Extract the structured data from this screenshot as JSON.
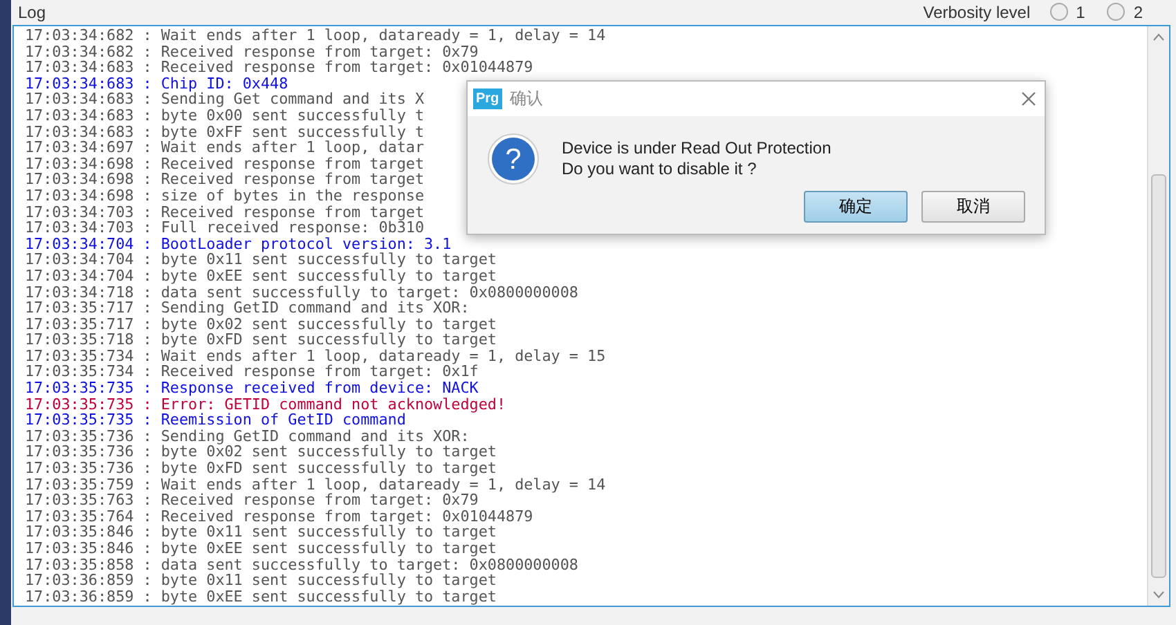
{
  "header": {
    "title": "Log",
    "verbosity": {
      "label": "Verbosity level",
      "options": [
        {
          "label": "1",
          "selected": false
        },
        {
          "label": "2",
          "selected": false
        }
      ]
    }
  },
  "log": {
    "lines": [
      {
        "kind": "info",
        "text": "17:03:34:682 : Wait ends after 1 loop, dataready = 1, delay = 14"
      },
      {
        "kind": "info",
        "text": "17:03:34:682 : Received response from target: 0x79"
      },
      {
        "kind": "info",
        "text": "17:03:34:683 : Received response from target: 0x01044879"
      },
      {
        "kind": "highlight",
        "text": "17:03:34:683 : Chip ID: 0x448"
      },
      {
        "kind": "info",
        "text": "17:03:34:683 : Sending Get command and its X"
      },
      {
        "kind": "info",
        "text": "17:03:34:683 : byte 0x00 sent successfully t"
      },
      {
        "kind": "info",
        "text": "17:03:34:683 : byte 0xFF sent successfully t"
      },
      {
        "kind": "info",
        "text": "17:03:34:697 : Wait ends after 1 loop, datar"
      },
      {
        "kind": "info",
        "text": "17:03:34:698 : Received response from target"
      },
      {
        "kind": "info",
        "text": "17:03:34:698 : Received response from target"
      },
      {
        "kind": "info",
        "text": "17:03:34:698 : size of bytes in the response"
      },
      {
        "kind": "info",
        "text": "17:03:34:703 : Received response from target"
      },
      {
        "kind": "info",
        "text": "17:03:34:703 : Full received response: 0b310"
      },
      {
        "kind": "highlight",
        "text": "17:03:34:704 : BootLoader protocol version: 3.1"
      },
      {
        "kind": "info",
        "text": "17:03:34:704 : byte 0x11 sent successfully to target"
      },
      {
        "kind": "info",
        "text": "17:03:34:704 : byte 0xEE sent successfully to target"
      },
      {
        "kind": "info",
        "text": "17:03:34:718 : data sent successfully to target: 0x0800000008"
      },
      {
        "kind": "info",
        "text": "17:03:35:717 : Sending GetID command and its XOR:"
      },
      {
        "kind": "info",
        "text": "17:03:35:717 : byte 0x02 sent successfully to target"
      },
      {
        "kind": "info",
        "text": "17:03:35:718 : byte 0xFD sent successfully to target"
      },
      {
        "kind": "info",
        "text": "17:03:35:734 : Wait ends after 1 loop, dataready = 1, delay = 15"
      },
      {
        "kind": "info",
        "text": "17:03:35:734 : Received response from target: 0x1f"
      },
      {
        "kind": "highlight",
        "text": "17:03:35:735 : Response received from device: NACK"
      },
      {
        "kind": "error",
        "text": "17:03:35:735 : Error: GETID command not acknowledged!"
      },
      {
        "kind": "highlight",
        "text": "17:03:35:735 : Reemission of GetID command"
      },
      {
        "kind": "info",
        "text": "17:03:35:736 : Sending GetID command and its XOR:"
      },
      {
        "kind": "info",
        "text": "17:03:35:736 : byte 0x02 sent successfully to target"
      },
      {
        "kind": "info",
        "text": "17:03:35:736 : byte 0xFD sent successfully to target"
      },
      {
        "kind": "info",
        "text": "17:03:35:759 : Wait ends after 1 loop, dataready = 1, delay = 14"
      },
      {
        "kind": "info",
        "text": "17:03:35:763 : Received response from target: 0x79"
      },
      {
        "kind": "info",
        "text": "17:03:35:764 : Received response from target: 0x01044879"
      },
      {
        "kind": "info",
        "text": "17:03:35:846 : byte 0x11 sent successfully to target"
      },
      {
        "kind": "info",
        "text": "17:03:35:846 : byte 0xEE sent successfully to target"
      },
      {
        "kind": "info",
        "text": "17:03:35:858 : data sent successfully to target: 0x0800000008"
      },
      {
        "kind": "info",
        "text": "17:03:36:859 : byte 0x11 sent successfully to target"
      },
      {
        "kind": "info",
        "text": "17:03:36:859 : byte 0xEE sent successfully to target"
      }
    ]
  },
  "dialog": {
    "app_icon": "Prg",
    "question_glyph": "?",
    "title": "确认",
    "message": [
      "Device is under Read Out Protection",
      "Do you want to disable it ?"
    ],
    "buttons": [
      {
        "label": "确定",
        "default": true
      },
      {
        "label": "取消",
        "default": false
      }
    ]
  }
}
